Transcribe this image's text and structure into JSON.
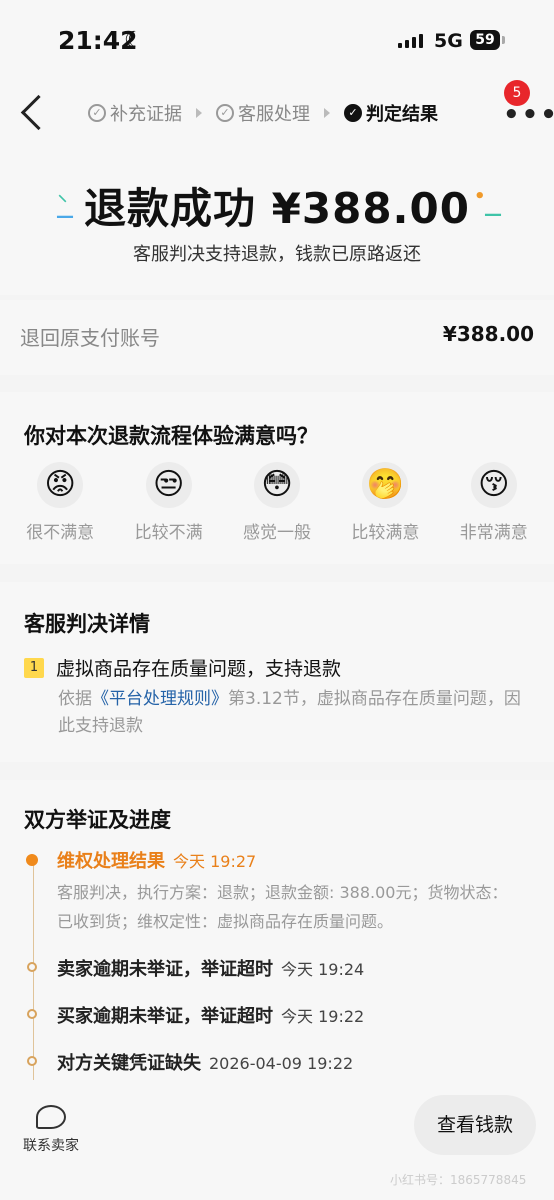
{
  "status": {
    "time": "21:42",
    "network": "5G",
    "battery": "59"
  },
  "nav": {
    "steps": [
      {
        "label": "补充证据",
        "state": "done"
      },
      {
        "label": "客服处理",
        "state": "done"
      },
      {
        "label": "判定结果",
        "state": "active"
      }
    ],
    "badge_count": "5"
  },
  "hero": {
    "title": "退款成功 ¥388.00",
    "subtitle": "客服判决支持退款，钱款已原路返还"
  },
  "account": {
    "label": "退回原支付账号",
    "amount": "¥388.00"
  },
  "satisfaction": {
    "title": "你对本次退款流程体验满意吗？",
    "options": [
      {
        "label": "很不满意",
        "emoji": "😡"
      },
      {
        "label": "比较不满",
        "emoji": "😒"
      },
      {
        "label": "感觉一般",
        "emoji": "😳"
      },
      {
        "label": "比较满意",
        "emoji": "🤭"
      },
      {
        "label": "非常满意",
        "emoji": "😚"
      }
    ]
  },
  "judgement": {
    "title": "客服判决详情",
    "index": "1",
    "item_title": "虚拟商品存在质量问题，支持退款",
    "desc_pre": "依据",
    "desc_link": "《平台处理规则》",
    "desc_post": "第3.12节，虚拟商品存在质量问题，因此支持退款"
  },
  "progress": {
    "title": "双方举证及进度",
    "events": [
      {
        "title": "维权处理结果",
        "time": "今天 19:27",
        "desc": "客服判决，执行方案：退款；退款金额: 388.00元；货物状态：已收到货；维权定性：虚拟商品存在质量问题。",
        "active": true
      },
      {
        "title": "卖家逾期未举证，举证超时",
        "time": "今天 19:24"
      },
      {
        "title": "买家逾期未举证，举证超时",
        "time": "今天 19:22"
      },
      {
        "title": "对方关键凭证缺失",
        "time": "2026-04-09 19:22"
      }
    ]
  },
  "bottom": {
    "contact_label": "联系卖家",
    "button_label": "查看钱款",
    "watermark": "小红书号：1865778845"
  },
  "colors": {
    "accent": "#e9801a",
    "link": "#2563a8",
    "badge": "#e8262b",
    "index_bg": "#ffd84d"
  }
}
